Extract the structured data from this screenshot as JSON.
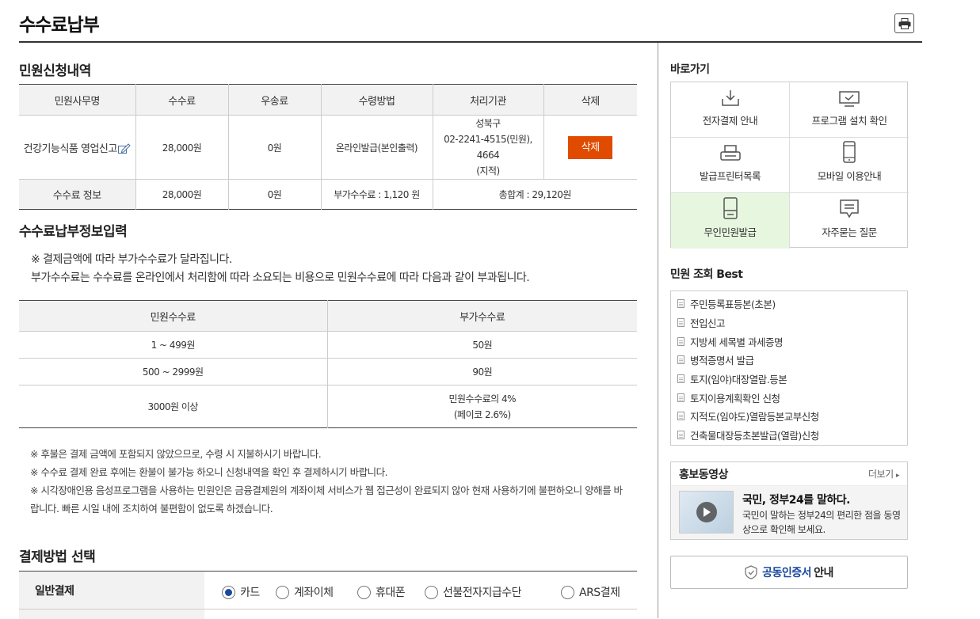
{
  "page": {
    "title": "수수료납부",
    "print_icon": "printer-icon"
  },
  "apply": {
    "title": "민원신청내역",
    "headers": [
      "민원사무명",
      "수수료",
      "우송료",
      "수령방법",
      "처리기관",
      "삭제"
    ],
    "row": {
      "name": "건강기능식품 영업신고",
      "fee": "28,000원",
      "postage": "0원",
      "method": "온라인발급(본인출력)",
      "agency_line1": "성북구",
      "agency_line2": "02-2241-4515(민원), 4664",
      "agency_line3": "(지적)",
      "delete_label": "삭제"
    },
    "fee_row": {
      "label": "수수료 정보",
      "fee": "28,000원",
      "postage": "0원",
      "extra": "부가수수료 : 1,120 원",
      "total": "총합계 : 29,120원"
    }
  },
  "payinfo": {
    "title": "수수료납부정보입력",
    "notice1": "※ 결제금액에 따라 부가수수료가 달라집니다.",
    "notice2": "부가수수료는 수수료를 온라인에서 처리함에 따라 소요되는 비용으로 민원수수료에 따라 다음과 같이 부과됩니다.",
    "headers": [
      "민원수수료",
      "부가수수료"
    ],
    "rows": [
      {
        "range": "1 ~ 499원",
        "extra": "50원"
      },
      {
        "range": "500 ~ 2999원",
        "extra": "90원"
      },
      {
        "range": "3000원 이상",
        "extra": "민원수수료의 4%",
        "extra2": "(페이코 2.6%)"
      }
    ],
    "notes": [
      "※ 후불은 결제 금액에 포함되지 않았으므로, 수령 시 지불하시기 바랍니다.",
      "※ 수수료 결제 완료 후에는 환불이 불가능 하오니 신청내역을 확인 후 결제하시기 바랍니다.",
      "※ 시각장애인용 음성프로그램을 사용하는 민원인은 금융결제원의 계좌이체 서비스가 웹 접근성이 완료되지 않아 현재 사용하기에 불편하오니 양해를 바랍니다. 빠른 시일 내에 조치하여 불편함이 없도록 하겠습니다."
    ]
  },
  "payment": {
    "title": "결제방법 선택",
    "general_label": "일반결제",
    "options": [
      "카드",
      "계좌이체",
      "휴대폰",
      "선불전자지급수단",
      "ARS결제"
    ],
    "selected": "카드"
  },
  "sidebar": {
    "quick_title": "바로가기",
    "quick": [
      {
        "label": "전자결제 안내",
        "icon": "download-icon"
      },
      {
        "label": "프로그램 설치 확인",
        "icon": "monitor-check-icon"
      },
      {
        "label": "발급프린터목록",
        "icon": "printer-icon"
      },
      {
        "label": "모바일 이용안내",
        "icon": "mobile-icon"
      },
      {
        "label": "무인민원발급",
        "icon": "kiosk-icon"
      },
      {
        "label": "자주묻는 질문",
        "icon": "chat-icon"
      }
    ],
    "best_title": "민원 조회 Best",
    "best": [
      "주민등록표등본(초본)",
      "전입신고",
      "지방세 세목별 과세증명",
      "병적증명서 발급",
      "토지(임야)대장열람.등본",
      "토지이용계획확인 신청",
      "지적도(임야도)열람등본교부신청",
      "건축물대장등초본발급(열람)신청"
    ],
    "video": {
      "title": "홍보동영상",
      "more": "더보기",
      "headline": "국민, 정부24를 말하다.",
      "desc": "국민이 말하는 정부24의 편리한 점을 동영상으로 확인해 보세요."
    },
    "cert": {
      "blue": "공동인증서",
      "rest": "안내"
    },
    "colors": {
      "accent": "#e04b00",
      "highlight": "#e7f7df",
      "link_blue": "#1a4aa0"
    }
  }
}
